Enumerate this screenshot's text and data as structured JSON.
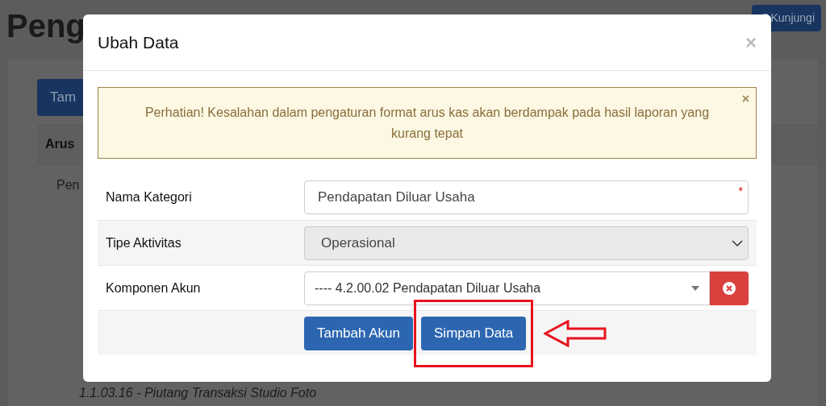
{
  "page": {
    "title": "Peng",
    "visit_button": "Kunjungi",
    "add_button": "Tam",
    "table_header": "Arus",
    "group_label": "Pen",
    "items": [
      "1.1.03.16 - Piutang Transaksi Studio Foto"
    ]
  },
  "modal": {
    "title": "Ubah Data",
    "close": "×",
    "alert": {
      "text": "Perhatian! Kesalahan dalam pengaturan format arus kas akan berdampak pada hasil laporan yang kurang tepat",
      "close": "×"
    },
    "fields": [
      {
        "kind": "text",
        "label": "Nama Kategori",
        "value": "Pendapatan Diluar Usaha",
        "required": true,
        "required_mark": "*"
      },
      {
        "kind": "select",
        "label": "Tipe Aktivitas",
        "value": "Operasional",
        "disabled": true
      },
      {
        "kind": "combo",
        "label": "Komponen Akun",
        "value": "---- 4.2.00.02 Pendapatan Diluar Usaha"
      }
    ],
    "buttons": [
      {
        "label": "Tambah Akun",
        "highlighted": false
      },
      {
        "label": "Simpan Data",
        "highlighted": true
      }
    ]
  }
}
